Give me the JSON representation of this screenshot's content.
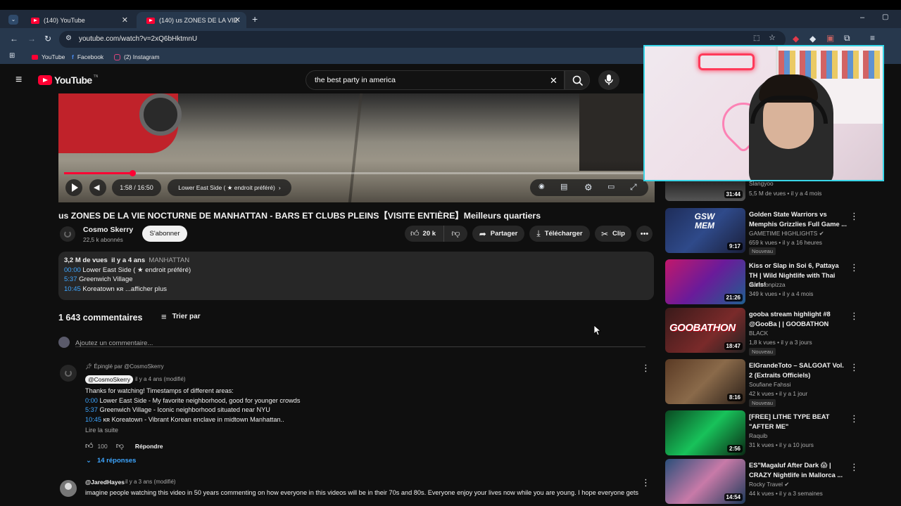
{
  "browser": {
    "tabs": [
      {
        "title": "(140) YouTube"
      },
      {
        "title": "(140) us ZONES DE LA VIE NOC"
      }
    ],
    "url": "youtube.com/watch?v=2xQ6bHktmnU",
    "bookmarks": [
      "YouTube",
      "Facebook",
      "(2) Instagram"
    ]
  },
  "youtube": {
    "logo": "YouTube",
    "logo_sup": "TN",
    "search_value": "the best party in america"
  },
  "player": {
    "time": "1:58 / 16:50",
    "chapter": "Lower East Side ( ★ endroit préféré)",
    "progress": 0.117
  },
  "video": {
    "title": "us ZONES DE LA VIE NOCTURNE DE MANHATTAN - BARS ET CLUBS PLEINS【VISITE ENTIÈRE】Meilleurs quartiers",
    "channel": "Cosmo Skerry",
    "subs": "22,5 k abonnés",
    "subscribe": "S'abonner",
    "likes": "20 k",
    "share": "Partager",
    "download": "Télécharger",
    "clip": "Clip"
  },
  "description": {
    "views": "3,2 M de vues",
    "age": "il y a 4 ans",
    "tag": "MANHATTAN",
    "lines": [
      {
        "ts": "00:00",
        "text": "Lower East Side ( ★ endroit préféré)"
      },
      {
        "ts": "5:37",
        "text": "Greenwich Village"
      },
      {
        "ts": "10:45",
        "text": "Koreatown ᴋʀ ...afficher plus"
      }
    ]
  },
  "comments": {
    "count": "1 643 commentaires",
    "sort": "Trier par",
    "add_placeholder": "Ajoutez un commentaire...",
    "pinned": {
      "pinned_label": "Épinglé par @CosmoSkerry",
      "author": "@CosmoSkerry",
      "age": "il y a 4 ans (modifié)",
      "intro": "Thanks for watching! Timestamps of different areas:",
      "lines": [
        {
          "ts": "0:00",
          "text": "Lower East Side - My favorite neighborhood, good for younger crowds"
        },
        {
          "ts": "5:37",
          "text": "Greenwich Village - Iconic neighborhood situated near NYU"
        },
        {
          "ts": "10:45",
          "text": "ᴋʀ Koreatown - Vibrant Korean enclave in midtown Manhattan.."
        }
      ],
      "read_more": "Lire la suite",
      "likes": "100",
      "reply": "Répondre",
      "replies": "14 réponses"
    },
    "second": {
      "author": "@JaredHayes",
      "age": "il y a 3 ans (modifié)",
      "text": "imagine people watching this video in 50 years commenting on how everyone in this videos will be in their 70s and 80s. Everyone enjoy your lives now while you are young. I hope everyone gets"
    }
  },
  "sidebar": [
    {
      "title": "",
      "channel": "Slangyoo",
      "meta": "5,5 M de vues • il y a 4 mois",
      "duration": "31:44",
      "badge": "",
      "color": "#3a3a3a"
    },
    {
      "title": "Golden State Warriors vs Memphis Grizzlies Full Game ...",
      "channel": "GAMETIME HIGHLIGHTS ✔",
      "meta": "659 k vues • il y a 16 heures",
      "duration": "9:17",
      "badge": "Nouveau",
      "color": "#23324f"
    },
    {
      "title": "Kiss or Slap in Soi 6, Pattaya TH | Wild Nightlife with Thai Girls!",
      "channel": "durianonpizza",
      "meta": "349 k vues • il y a 4 mois",
      "duration": "21:26",
      "badge": "",
      "color": "#8b1c4b"
    },
    {
      "title": "gooba stream highlight #8 @GooBa | | GOOBATHON",
      "channel": "BLACK",
      "meta": "1,8 k vues • il y a 3 jours",
      "duration": "18:47",
      "badge": "Nouveau",
      "color": "#5a2a2a"
    },
    {
      "title": "ElGrandeToto – SALGOAT Vol. 2 (Extraits Officiels)",
      "channel": "Soufiane Fahssi",
      "meta": "42 k vues • il y a 1 jour",
      "duration": "8:16",
      "badge": "Nouveau",
      "color": "#6b4a34"
    },
    {
      "title": "[FREE] LITHE TYPE BEAT \"AFTER ME\"",
      "channel": "Raquib",
      "meta": "31 k vues • il y a 10 jours",
      "duration": "2:56",
      "badge": "",
      "color": "#0f7a3a"
    },
    {
      "title": "ES\"Magaluf After Dark 😱 | CRAZY Nightlife in Mallorca ...",
      "channel": "Rocky Travel ✔",
      "meta": "44 k vues • il y a 3 semaines",
      "duration": "14:54",
      "badge": "",
      "color": "#2b4f7a"
    }
  ],
  "thumb_texts": {
    "gsw": "GSW MEM",
    "goobathon": "GOOBATHON"
  }
}
